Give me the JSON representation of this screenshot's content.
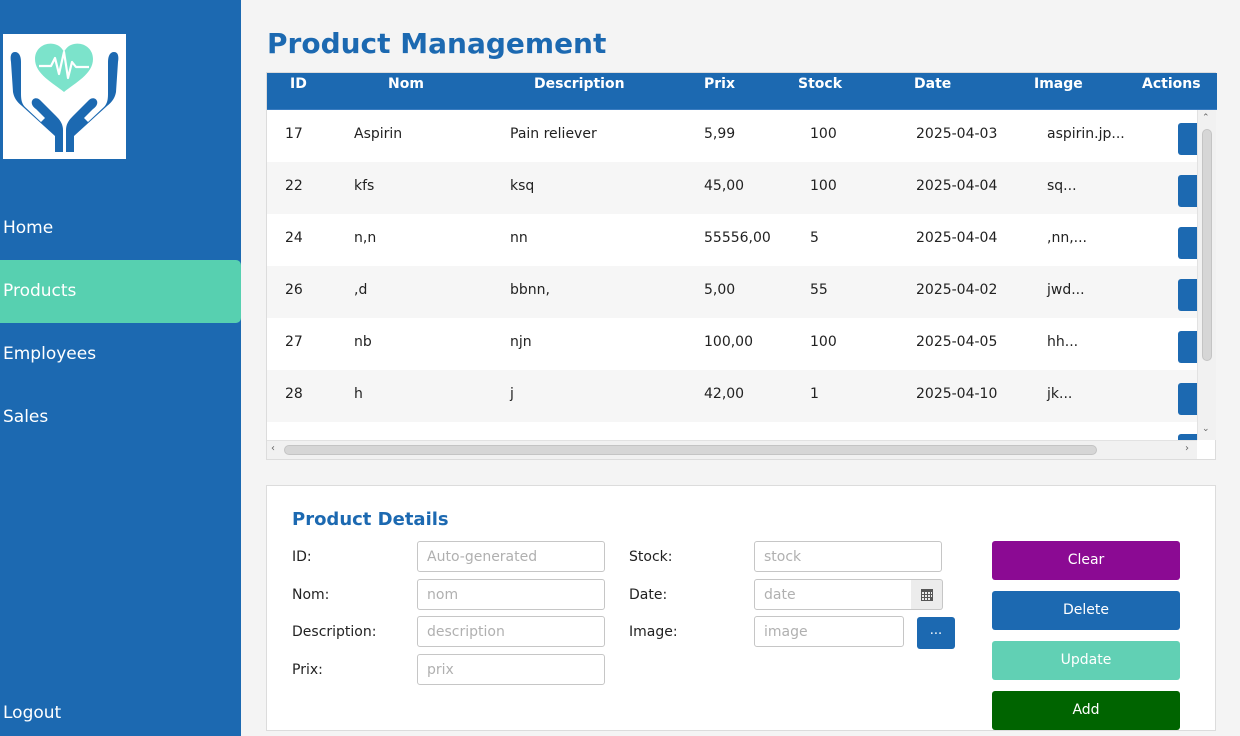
{
  "sidebar": {
    "nav": [
      "Home",
      "Products",
      "Employees",
      "Sales"
    ],
    "active": "Products",
    "logout": "Logout",
    "logo_icon": "heart-hands-icon",
    "colors": {
      "background": "#1c69b1",
      "active": "#57d0b0"
    }
  },
  "title": "Product Management",
  "table": {
    "columns": [
      "ID",
      "Nom",
      "Description",
      "Prix",
      "Stock",
      "Date",
      "Image",
      "Actions"
    ],
    "rows": [
      [
        "17",
        "Aspirin",
        "Pain reliever",
        "5,99",
        "100",
        "2025-04-03",
        "aspirin.jp..."
      ],
      [
        "22",
        "kfs",
        "ksq",
        "45,00",
        "100",
        "2025-04-04",
        "sq..."
      ],
      [
        "24",
        "n,n",
        "nn",
        "55556,00",
        "5",
        "2025-04-04",
        ",nn,..."
      ],
      [
        "26",
        ",d",
        "bbnn,",
        "5,00",
        "55",
        "2025-04-02",
        "jwd..."
      ],
      [
        "27",
        "nb",
        "njn",
        "100,00",
        "100",
        "2025-04-05",
        "hh..."
      ],
      [
        "28",
        "h",
        "j",
        "42,00",
        "1",
        "2025-04-10",
        "jk..."
      ]
    ]
  },
  "details": {
    "title": "Product Details",
    "labels": {
      "id": "ID:",
      "nom": "Nom:",
      "description": "Description:",
      "prix": "Prix:",
      "stock": "Stock:",
      "date": "Date:",
      "image": "Image:"
    },
    "placeholders": {
      "id": "Auto-generated",
      "nom": "nom",
      "description": "description",
      "prix": "prix",
      "stock": "stock",
      "date": "date",
      "image": "image"
    },
    "browse_label": "...",
    "calendar_icon": "calendar-icon"
  },
  "actions": {
    "clear": "Clear",
    "delete": "Delete",
    "update": "Update",
    "add": "Add",
    "colors": {
      "clear": "#8b0a93",
      "delete": "#1c69b1",
      "update": "#61d0b4",
      "add": "#006400"
    }
  }
}
